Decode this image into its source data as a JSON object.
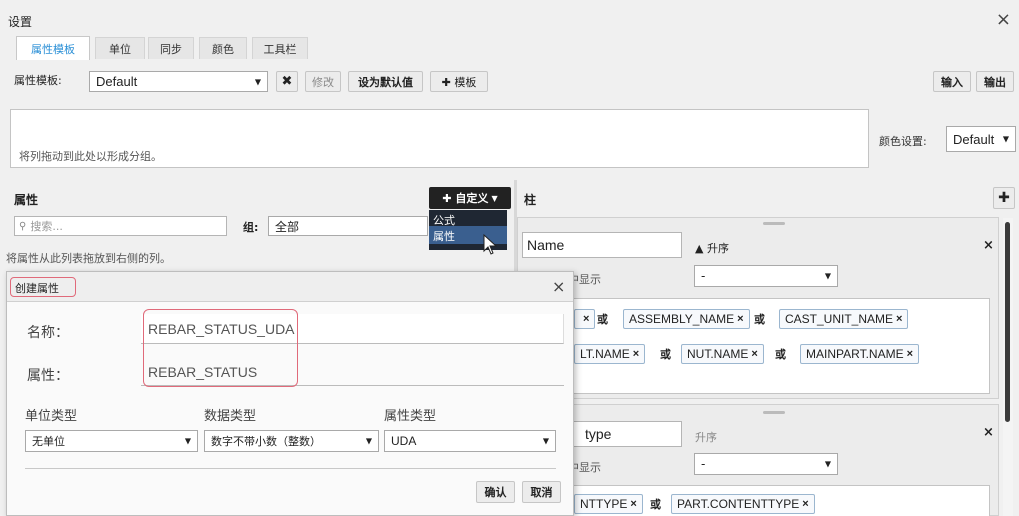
{
  "window": {
    "title": "设置",
    "close_glyph": "×"
  },
  "tabs": [
    {
      "label": "属性模板",
      "active": true
    },
    {
      "label": "单位",
      "active": false
    },
    {
      "label": "同步",
      "active": false
    },
    {
      "label": "颜色",
      "active": false
    },
    {
      "label": "工具栏",
      "active": false
    }
  ],
  "toolbar": {
    "template_label": "属性模板:",
    "template_value": "Default",
    "delete_glyph": "✖",
    "modify_label": "修改",
    "set_default_label": "设为默认值",
    "add_template_label": "✚ 模板",
    "import_label": "输入",
    "export_label": "输出"
  },
  "group_area": {
    "hint": "将列拖动到此处以形成分组。",
    "color_label": "颜色设置:",
    "color_value": "Default"
  },
  "attributes_panel": {
    "title": "属性",
    "custom_button": "✚ 自定义",
    "dropdown_items": [
      "公式",
      "属性"
    ],
    "search_placeholder": "搜索...",
    "group_label": "组:",
    "group_value": "全部",
    "drag_hint": "将属性从此列表拖放到右侧的列。"
  },
  "columns_panel": {
    "title": "柱",
    "add_glyph": "✚",
    "columns": [
      {
        "name": "Name",
        "sort": "▲ 升序",
        "show_label": "中显示",
        "show_value": "-",
        "chips_row1": [
          "ASSEMBLY_NAME",
          "CAST_UNIT_NAME"
        ],
        "chips_row2": [
          "LT.NAME",
          "NUT.NAME",
          "MAINPART.NAME"
        ],
        "or_text": "或"
      },
      {
        "name": "type",
        "sort": "升序",
        "show_label": "中显示",
        "show_value": "-",
        "chips_row1": [
          "NTTYPE",
          "PART.CONTENTTYPE"
        ],
        "or_text": "或"
      }
    ]
  },
  "create_dialog": {
    "title": "创建属性",
    "close_glyph": "×",
    "name_label": "名称：",
    "name_value": "REBAR_STATUS_UDA",
    "attr_label": "属性：",
    "attr_value": "REBAR_STATUS",
    "unit_type_label": "单位类型",
    "data_type_label": "数据类型",
    "attr_type_label": "属性类型",
    "unit_type_value": "无单位",
    "data_type_value": "数字不带小数（整数）",
    "attr_type_value": "UDA",
    "confirm_label": "确认",
    "cancel_label": "取消"
  },
  "colors": {
    "accent": "#2a8fd6",
    "highlight": "#e06a7a",
    "menu_bg": "#1f2733",
    "menu_selected": "#3a5f8f"
  }
}
